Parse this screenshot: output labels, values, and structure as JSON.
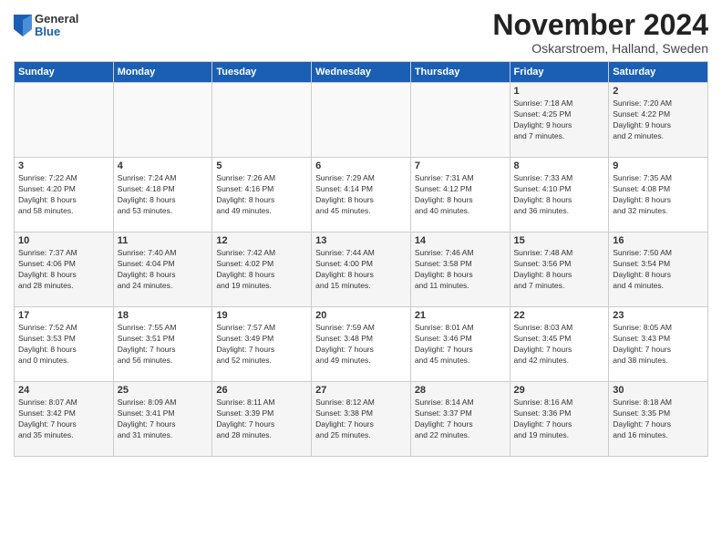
{
  "logo": {
    "general": "General",
    "blue": "Blue"
  },
  "title": "November 2024",
  "location": "Oskarstroem, Halland, Sweden",
  "days_header": [
    "Sunday",
    "Monday",
    "Tuesday",
    "Wednesday",
    "Thursday",
    "Friday",
    "Saturday"
  ],
  "weeks": [
    [
      {
        "day": "",
        "info": ""
      },
      {
        "day": "",
        "info": ""
      },
      {
        "day": "",
        "info": ""
      },
      {
        "day": "",
        "info": ""
      },
      {
        "day": "",
        "info": ""
      },
      {
        "day": "1",
        "info": "Sunrise: 7:18 AM\nSunset: 4:25 PM\nDaylight: 9 hours\nand 7 minutes."
      },
      {
        "day": "2",
        "info": "Sunrise: 7:20 AM\nSunset: 4:22 PM\nDaylight: 9 hours\nand 2 minutes."
      }
    ],
    [
      {
        "day": "3",
        "info": "Sunrise: 7:22 AM\nSunset: 4:20 PM\nDaylight: 8 hours\nand 58 minutes."
      },
      {
        "day": "4",
        "info": "Sunrise: 7:24 AM\nSunset: 4:18 PM\nDaylight: 8 hours\nand 53 minutes."
      },
      {
        "day": "5",
        "info": "Sunrise: 7:26 AM\nSunset: 4:16 PM\nDaylight: 8 hours\nand 49 minutes."
      },
      {
        "day": "6",
        "info": "Sunrise: 7:29 AM\nSunset: 4:14 PM\nDaylight: 8 hours\nand 45 minutes."
      },
      {
        "day": "7",
        "info": "Sunrise: 7:31 AM\nSunset: 4:12 PM\nDaylight: 8 hours\nand 40 minutes."
      },
      {
        "day": "8",
        "info": "Sunrise: 7:33 AM\nSunset: 4:10 PM\nDaylight: 8 hours\nand 36 minutes."
      },
      {
        "day": "9",
        "info": "Sunrise: 7:35 AM\nSunset: 4:08 PM\nDaylight: 8 hours\nand 32 minutes."
      }
    ],
    [
      {
        "day": "10",
        "info": "Sunrise: 7:37 AM\nSunset: 4:06 PM\nDaylight: 8 hours\nand 28 minutes."
      },
      {
        "day": "11",
        "info": "Sunrise: 7:40 AM\nSunset: 4:04 PM\nDaylight: 8 hours\nand 24 minutes."
      },
      {
        "day": "12",
        "info": "Sunrise: 7:42 AM\nSunset: 4:02 PM\nDaylight: 8 hours\nand 19 minutes."
      },
      {
        "day": "13",
        "info": "Sunrise: 7:44 AM\nSunset: 4:00 PM\nDaylight: 8 hours\nand 15 minutes."
      },
      {
        "day": "14",
        "info": "Sunrise: 7:46 AM\nSunset: 3:58 PM\nDaylight: 8 hours\nand 11 minutes."
      },
      {
        "day": "15",
        "info": "Sunrise: 7:48 AM\nSunset: 3:56 PM\nDaylight: 8 hours\nand 7 minutes."
      },
      {
        "day": "16",
        "info": "Sunrise: 7:50 AM\nSunset: 3:54 PM\nDaylight: 8 hours\nand 4 minutes."
      }
    ],
    [
      {
        "day": "17",
        "info": "Sunrise: 7:52 AM\nSunset: 3:53 PM\nDaylight: 8 hours\nand 0 minutes."
      },
      {
        "day": "18",
        "info": "Sunrise: 7:55 AM\nSunset: 3:51 PM\nDaylight: 7 hours\nand 56 minutes."
      },
      {
        "day": "19",
        "info": "Sunrise: 7:57 AM\nSunset: 3:49 PM\nDaylight: 7 hours\nand 52 minutes."
      },
      {
        "day": "20",
        "info": "Sunrise: 7:59 AM\nSunset: 3:48 PM\nDaylight: 7 hours\nand 49 minutes."
      },
      {
        "day": "21",
        "info": "Sunrise: 8:01 AM\nSunset: 3:46 PM\nDaylight: 7 hours\nand 45 minutes."
      },
      {
        "day": "22",
        "info": "Sunrise: 8:03 AM\nSunset: 3:45 PM\nDaylight: 7 hours\nand 42 minutes."
      },
      {
        "day": "23",
        "info": "Sunrise: 8:05 AM\nSunset: 3:43 PM\nDaylight: 7 hours\nand 38 minutes."
      }
    ],
    [
      {
        "day": "24",
        "info": "Sunrise: 8:07 AM\nSunset: 3:42 PM\nDaylight: 7 hours\nand 35 minutes."
      },
      {
        "day": "25",
        "info": "Sunrise: 8:09 AM\nSunset: 3:41 PM\nDaylight: 7 hours\nand 31 minutes."
      },
      {
        "day": "26",
        "info": "Sunrise: 8:11 AM\nSunset: 3:39 PM\nDaylight: 7 hours\nand 28 minutes."
      },
      {
        "day": "27",
        "info": "Sunrise: 8:12 AM\nSunset: 3:38 PM\nDaylight: 7 hours\nand 25 minutes."
      },
      {
        "day": "28",
        "info": "Sunrise: 8:14 AM\nSunset: 3:37 PM\nDaylight: 7 hours\nand 22 minutes."
      },
      {
        "day": "29",
        "info": "Sunrise: 8:16 AM\nSunset: 3:36 PM\nDaylight: 7 hours\nand 19 minutes."
      },
      {
        "day": "30",
        "info": "Sunrise: 8:18 AM\nSunset: 3:35 PM\nDaylight: 7 hours\nand 16 minutes."
      }
    ]
  ]
}
